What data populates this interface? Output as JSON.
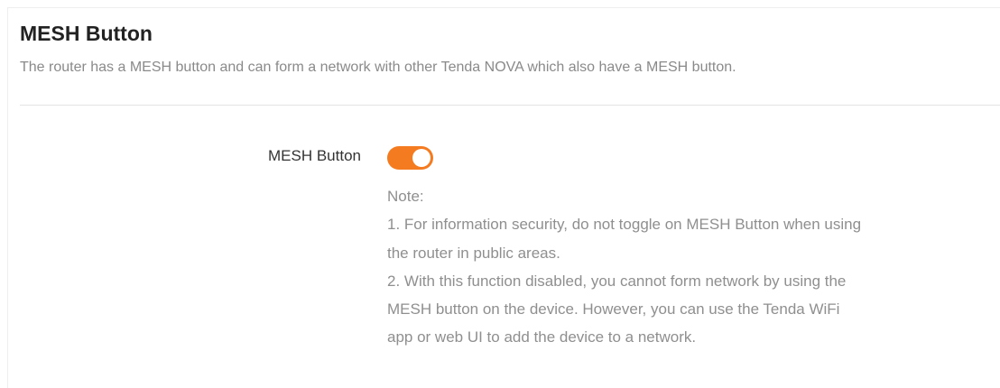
{
  "section": {
    "title": "MESH Button",
    "description": "The router has a MESH button and can form a network with other Tenda NOVA which also have a MESH button."
  },
  "mesh_button": {
    "label": "MESH Button",
    "enabled": true,
    "toggle_color": "#f47b20"
  },
  "note": {
    "heading": "Note:",
    "item1": "1. For information security, do not toggle on MESH Button when using the router in public areas.",
    "item2": "2. With this function disabled, you cannot form network by using the MESH button on the device. However, you can use the Tenda WiFi app or web UI to add the device to a network."
  }
}
